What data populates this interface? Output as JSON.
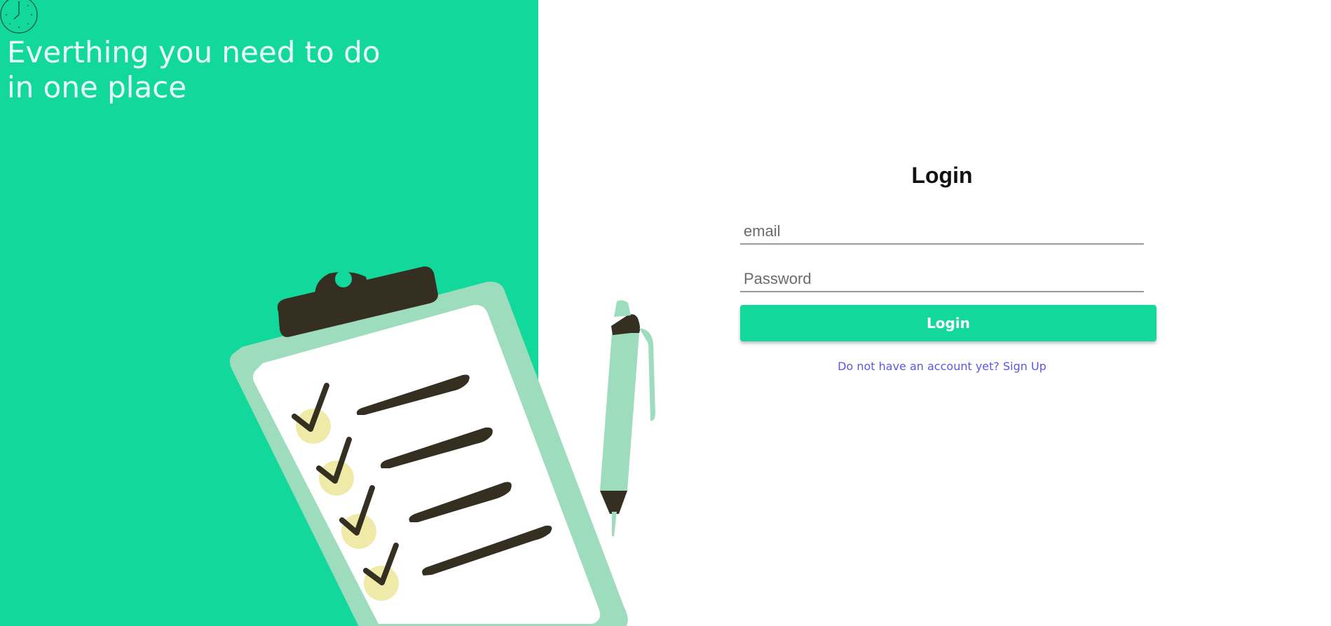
{
  "hero": {
    "tagline_line1": "Everthing you need to do",
    "tagline_line2": "in one place"
  },
  "login": {
    "title": "Login",
    "email_placeholder": "email",
    "email_value": "",
    "password_placeholder": "Password",
    "password_value": "",
    "button_label": "Login",
    "signup_text": "Do not have an account yet? Sign Up"
  },
  "colors": {
    "accent": "#13d89c",
    "link": "#5b56e8",
    "illustration_light_green": "#9ddcbc",
    "illustration_dark": "#352f21",
    "check_circle": "#efeaa8"
  },
  "icons": {
    "logo": "clock-icon",
    "illustration": "clipboard-checklist-illustration"
  }
}
